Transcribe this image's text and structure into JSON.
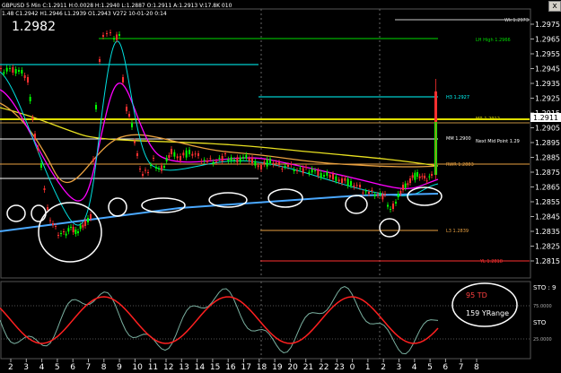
{
  "header": {
    "symbol_line": "GBPUSD 5 Min C:1.2911 H:0.0028 H:1.2940 L:1.2887 O:1.2911 A:1.2913 V:17.8K 010",
    "info_line": "1.48 C1.2942 H1.2946 L1.2939 O1.2943 V272 10-01-20 0:14",
    "price_display": "1.2982",
    "close_label": "x"
  },
  "price_axis": {
    "ticks": [
      "1.2975",
      "1.2965",
      "1.2955",
      "1.2945",
      "1.2935",
      "1.2925",
      "1.2915",
      "1.2905",
      "1.2895",
      "1.2885",
      "1.2875",
      "1.2865",
      "1.2855",
      "1.2845",
      "1.2835",
      "1.2825",
      "1.2815"
    ],
    "current_price": "1.2911"
  },
  "time_axis": {
    "labels": [
      "2",
      "3",
      "4",
      "5",
      "6",
      "7",
      "8",
      "9",
      "10",
      "11",
      "12",
      "13",
      "14",
      "15",
      "16",
      "17",
      "18",
      "19",
      "20",
      "21",
      "22",
      "23",
      "0",
      "1",
      "2",
      "3",
      "4",
      "5",
      "6",
      "7",
      "8"
    ]
  },
  "levels": [
    {
      "label": "Wk 1.2973",
      "color": "#cccccc"
    },
    {
      "label": "LH High 1.2966",
      "color": "#00dd00"
    },
    {
      "label": "",
      "color": "#00ffff"
    },
    {
      "label": "H3 1.2927",
      "color": "#00ffff"
    },
    {
      "label": "MR 1.2912",
      "color": "#dddd00"
    },
    {
      "label": "MM 1.2900",
      "color": "#ffffff"
    },
    {
      "label": "Next Mid Point 1.29",
      "color": "#ffffff"
    },
    {
      "label": "RWR 1.2883",
      "color": "#e8a040"
    },
    {
      "label": "L3 1.2839",
      "color": "#e8a040"
    },
    {
      "label": "YL 1.2818",
      "color": "#ff3030"
    }
  ],
  "indicator": {
    "name": "STO",
    "top_label": "STO : 9",
    "bottom_label": "STO",
    "level_high": "75.0000",
    "level_mid": "25.0000",
    "annotation_td": "95 TD",
    "annotation_range": "159 YRange"
  },
  "colors": {
    "bull": "#00ff00",
    "bear": "#ff3030",
    "blue_ma": "#4aa8ff",
    "yellow_ma": "#e8e020",
    "magenta_ma": "#ff00ff",
    "cyan_ma": "#00e0e0",
    "orange_ma": "#e8a040",
    "sto_k": "#7ab0a0",
    "sto_d": "#ff2020"
  }
}
